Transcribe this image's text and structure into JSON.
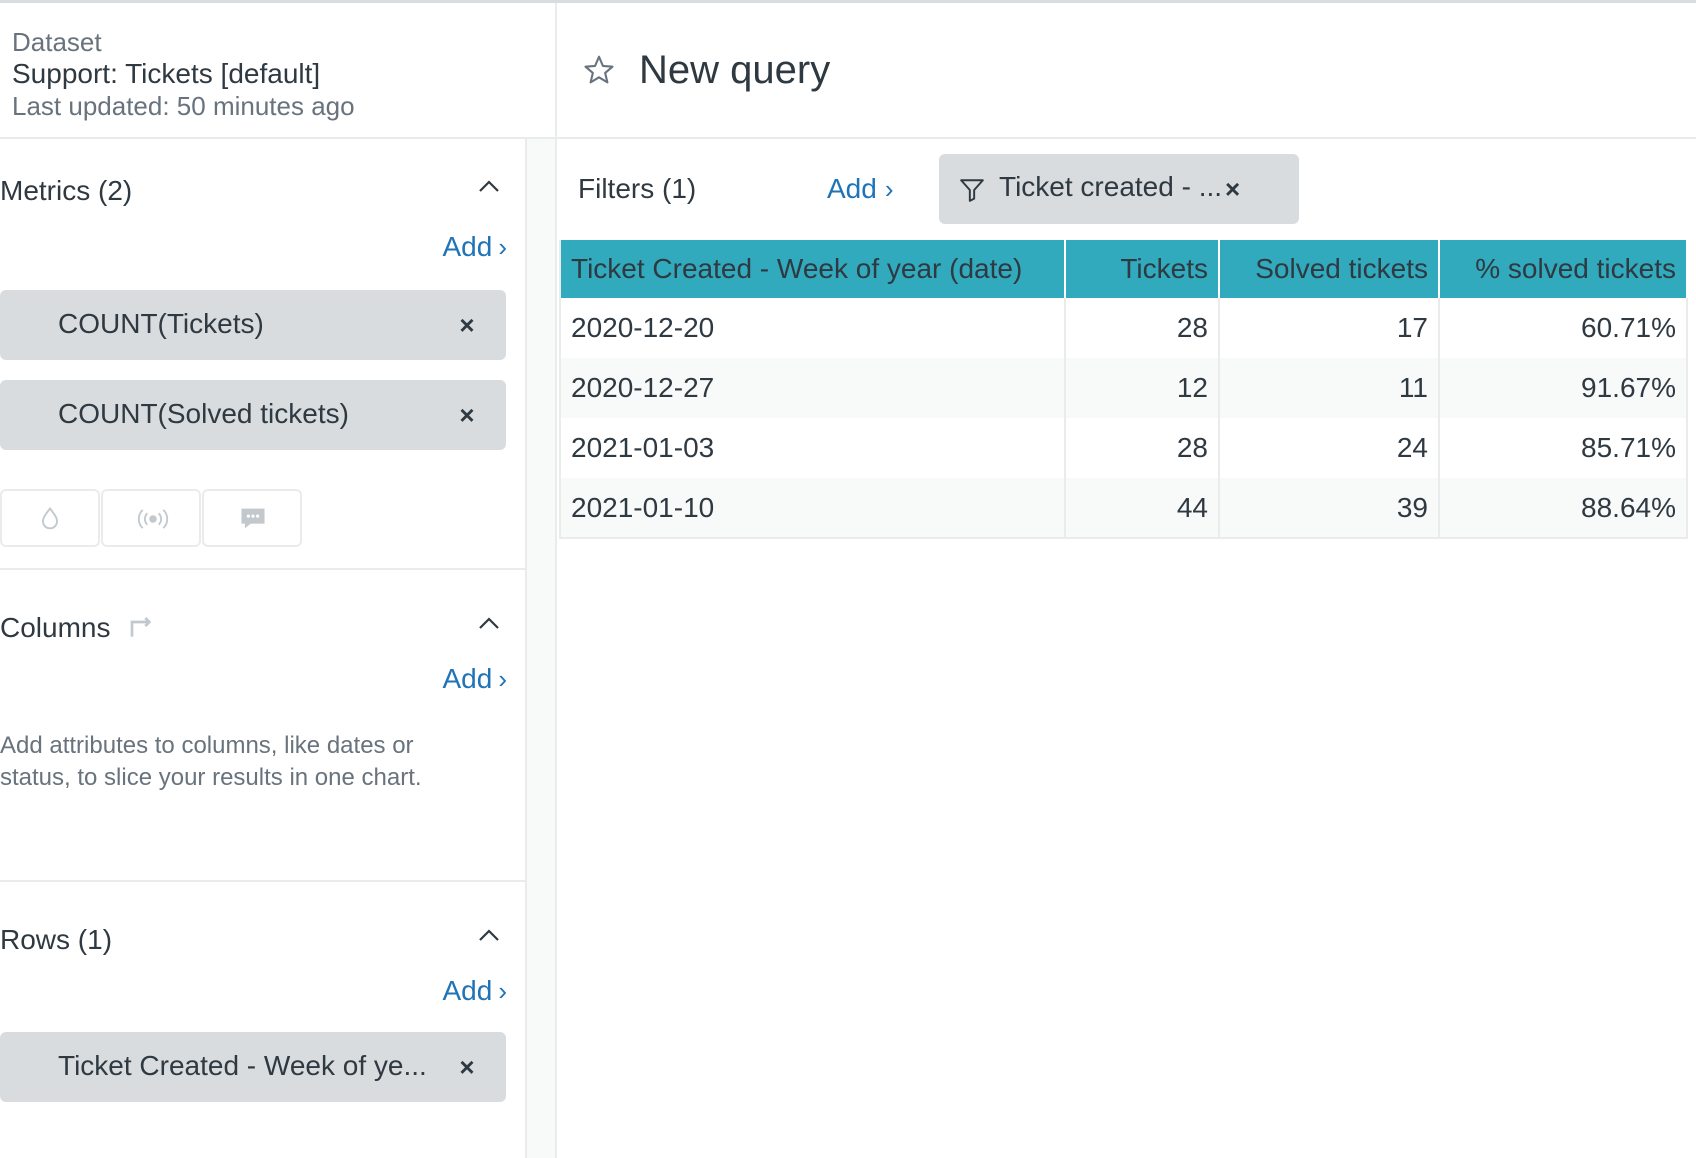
{
  "dataset": {
    "label": "Dataset",
    "name": "Support: Tickets [default]",
    "last_updated": "Last updated: 50 minutes ago"
  },
  "query": {
    "title": "New query",
    "icon": "star-icon"
  },
  "sidebar": {
    "metrics": {
      "title": "Metrics (2)",
      "add_label": "Add",
      "items": [
        {
          "label": "COUNT(Tickets)"
        },
        {
          "label": "COUNT(Solved tickets)"
        }
      ],
      "icon_buttons": [
        "drop-icon",
        "broadcast-icon",
        "comment-icon"
      ]
    },
    "columns": {
      "title": "Columns",
      "add_label": "Add",
      "hint": "Add attributes to columns, like dates or status, to slice your results in one chart."
    },
    "rows": {
      "title": "Rows (1)",
      "add_label": "Add",
      "items": [
        {
          "label": "Ticket Created - Week of ye..."
        }
      ]
    }
  },
  "filters": {
    "label": "Filters (1)",
    "add_label": "Add",
    "items": [
      {
        "label": "Ticket created - ..."
      }
    ]
  },
  "table": {
    "headers": [
      "Ticket Created - Week of year (date)",
      "Tickets",
      "Solved tickets",
      "% solved tickets"
    ],
    "rows": [
      [
        "2020-12-20",
        "28",
        "17",
        "60.71%"
      ],
      [
        "2020-12-27",
        "12",
        "11",
        "91.67%"
      ],
      [
        "2021-01-03",
        "28",
        "24",
        "85.71%"
      ],
      [
        "2021-01-10",
        "44",
        "39",
        "88.64%"
      ]
    ]
  },
  "colors": {
    "accent_link": "#1f73b7",
    "table_header": "#30aabc",
    "pill_bg": "#d8dcde"
  }
}
